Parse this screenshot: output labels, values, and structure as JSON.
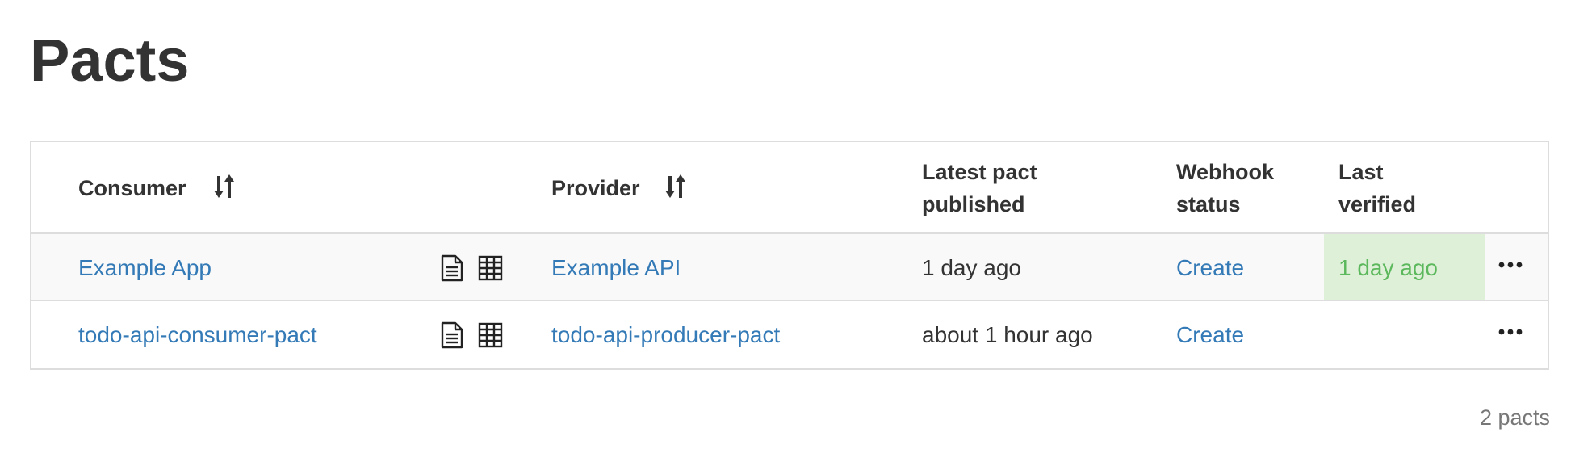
{
  "page": {
    "title": "Pacts"
  },
  "table": {
    "headers": {
      "consumer": "Consumer",
      "provider": "Provider",
      "latest_line1": "Latest pact",
      "latest_line2": "published",
      "webhook_line1": "Webhook",
      "webhook_line2": "status",
      "verified_line1": "Last",
      "verified_line2": "verified"
    },
    "rows": [
      {
        "consumer": "Example App",
        "provider": "Example API",
        "latest_published": "1 day ago",
        "webhook_status": "Create",
        "last_verified": "1 day ago",
        "actions_icon": "ellipsis-icon"
      },
      {
        "consumer": "todo-api-consumer-pact",
        "provider": "todo-api-producer-pact",
        "latest_published": "about 1 hour ago",
        "webhook_status": "Create",
        "last_verified": "",
        "actions_icon": "ellipsis-icon"
      }
    ]
  },
  "footer": {
    "count": "2 pacts"
  },
  "icons": {
    "sort": "sort-icon",
    "document": "document-icon",
    "matrix": "grid-table-icon"
  },
  "colors": {
    "link": "#337ab7",
    "verified_bg": "#dff0d8",
    "verified_text": "#5cb85c",
    "row_stripe": "#f9f9f9",
    "border": "#dddddd"
  }
}
